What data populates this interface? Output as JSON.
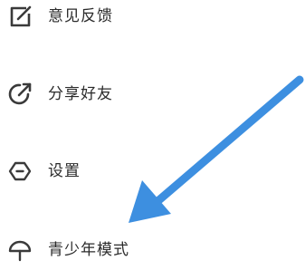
{
  "menu": {
    "items": [
      {
        "label": "意见反馈",
        "icon": "edit-icon"
      },
      {
        "label": "分享好友",
        "icon": "share-icon"
      },
      {
        "label": "设置",
        "icon": "settings-icon"
      },
      {
        "label": "青少年模式",
        "icon": "umbrella-icon"
      }
    ]
  },
  "annotation": {
    "arrow_color": "#3d8fe0",
    "arrow_target": "青少年模式"
  },
  "colors": {
    "text": "#2b2b2b",
    "icon": "#3a3a3a",
    "background": "#ffffff"
  }
}
